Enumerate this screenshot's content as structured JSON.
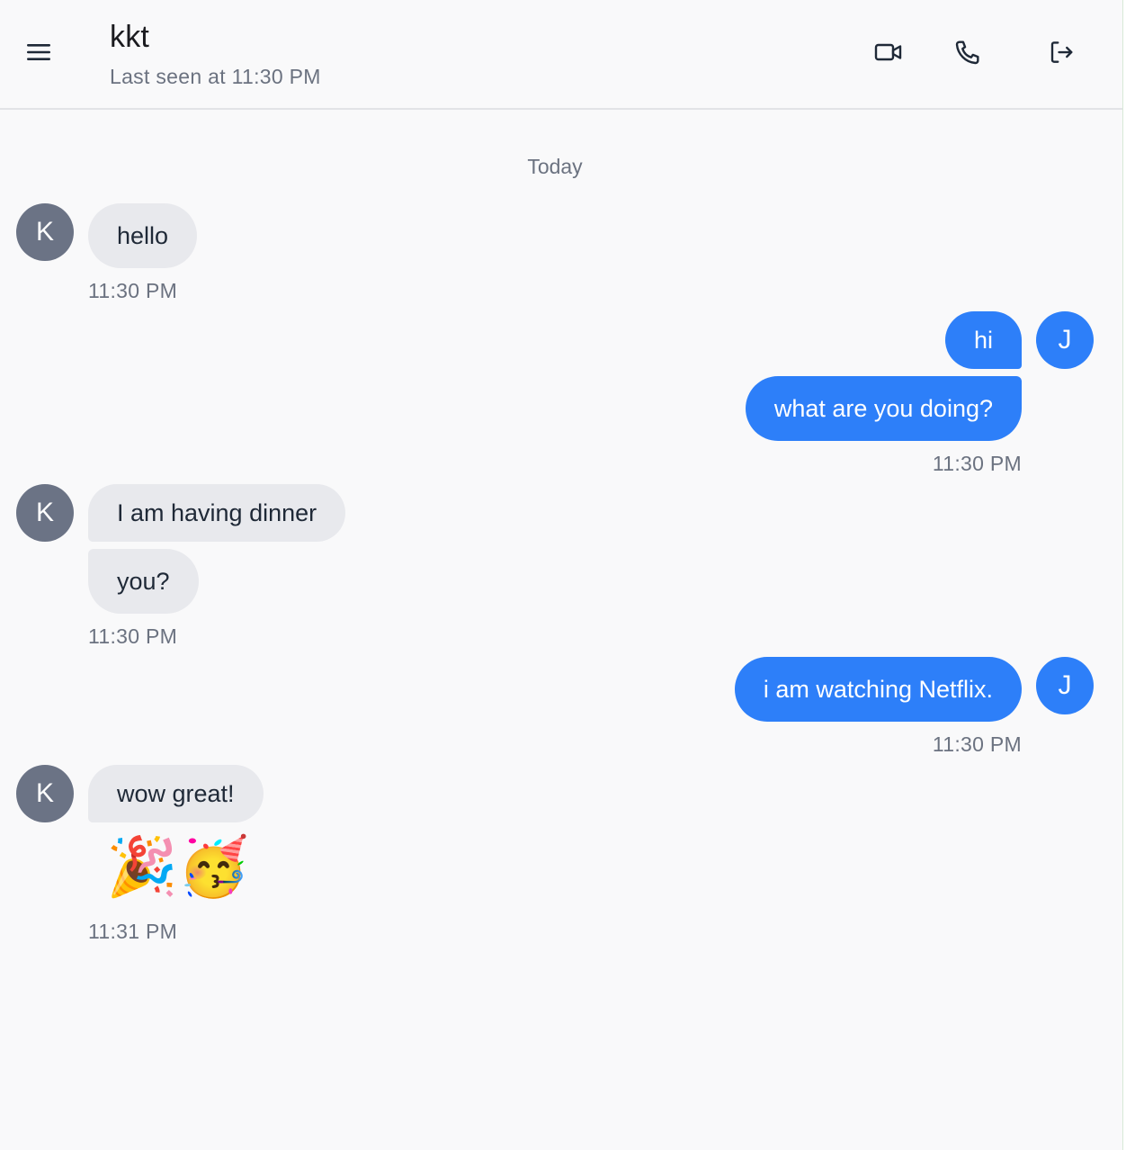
{
  "header": {
    "title": "kkt",
    "subtitle": "Last seen at 11:30 PM",
    "menu_icon": "hamburger-menu-icon",
    "actions": [
      "video-camera-icon",
      "phone-icon",
      "logout-icon"
    ]
  },
  "day_separator": "Today",
  "avatars": {
    "contact": "K",
    "me": "J"
  },
  "messages": [
    {
      "from": "contact",
      "text": "hello"
    },
    {
      "from": "contact",
      "time": "11:30 PM"
    },
    {
      "from": "me",
      "text": "hi"
    },
    {
      "from": "me",
      "text": "what are you doing?"
    },
    {
      "from": "me",
      "time": "11:30 PM"
    },
    {
      "from": "contact",
      "text": "I am having dinner"
    },
    {
      "from": "contact",
      "text": "you?"
    },
    {
      "from": "contact",
      "time": "11:30 PM"
    },
    {
      "from": "me",
      "text": "i am watching Netflix."
    },
    {
      "from": "me",
      "time": "11:30 PM"
    },
    {
      "from": "contact",
      "text": "wow great!"
    },
    {
      "from": "contact",
      "emoji": "🎉🥳"
    },
    {
      "from": "contact",
      "time": "11:31 PM"
    }
  ],
  "colors": {
    "outgoing_bubble": "#2d7ff9",
    "incoming_bubble": "#e8e9ed",
    "contact_avatar": "#6b7385",
    "my_avatar": "#2d7ff9"
  }
}
